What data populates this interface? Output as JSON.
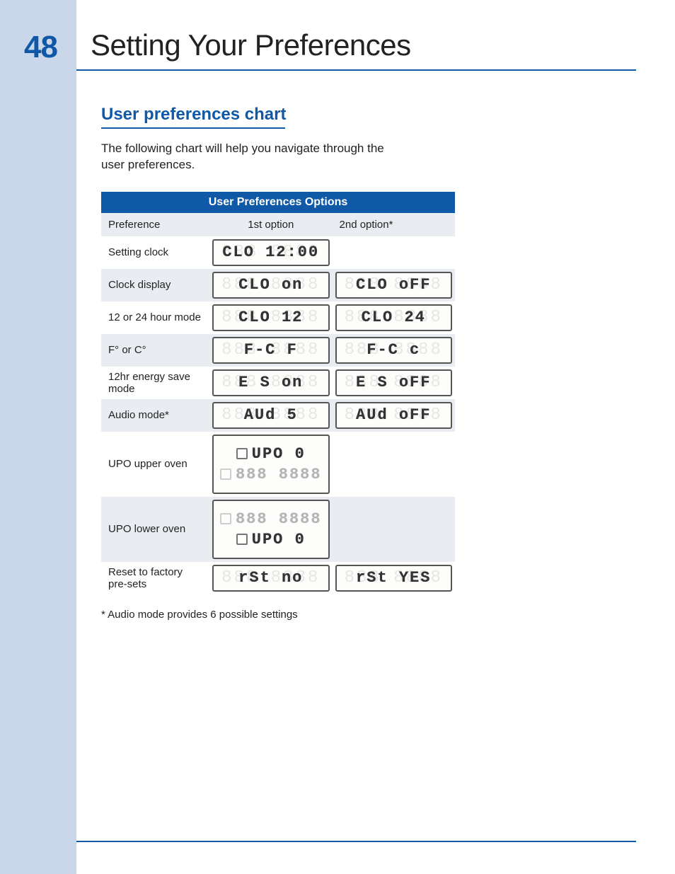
{
  "page_number": "48",
  "title": "Setting Your Preferences",
  "section_heading": "User preferences chart",
  "intro": "The following chart will help you navigate through the user preferences.",
  "table": {
    "caption": "User Preferences Options",
    "col_preference": "Preference",
    "col_option1": "1st option",
    "col_option2": "2nd option*",
    "rows": [
      {
        "label": "Setting clock",
        "opt1": "CLO 12:00",
        "opt2": ""
      },
      {
        "label": "Clock display",
        "opt1": "CLO on",
        "opt2": "CLO oFF"
      },
      {
        "label": "12 or 24 hour mode",
        "opt1": "CLO 12",
        "opt2": "CLO 24"
      },
      {
        "label": "F° or C°",
        "opt1": "F-C F",
        "opt2": "F-C c"
      },
      {
        "label": "12hr energy save mode",
        "opt1": "E S on",
        "opt2": "E S oFF"
      },
      {
        "label": "Audio mode*",
        "opt1": "AUd  5",
        "opt2": "AUd oFF"
      },
      {
        "label": "UPO upper oven",
        "opt1": "UPO    0",
        "opt2": ""
      },
      {
        "label": "UPO lower oven",
        "opt1": "UPO    0",
        "opt2": ""
      },
      {
        "label": "Reset to factory pre-sets",
        "opt1": "rSt no",
        "opt2": "rSt YES"
      }
    ]
  },
  "footnote": "* Audio mode provides 6 possible settings",
  "ghost": "888 8888"
}
